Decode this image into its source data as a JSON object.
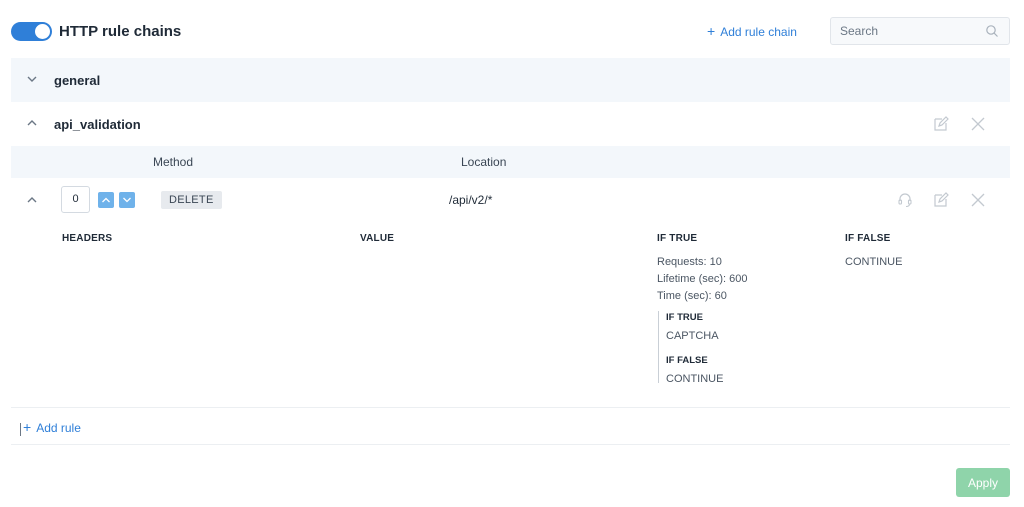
{
  "header": {
    "toggle_on": true,
    "title": "HTTP rule chains",
    "add_chain_label": "Add rule chain",
    "search_placeholder": "Search"
  },
  "chains": [
    {
      "name": "general",
      "expanded": false
    },
    {
      "name": "api_validation",
      "expanded": true
    }
  ],
  "rules_table": {
    "columns": {
      "method": "Method",
      "location": "Location"
    },
    "rule": {
      "order": "0",
      "method": "DELETE",
      "location": "/api/v2/*"
    }
  },
  "conditions": {
    "headers_label": "HEADERS",
    "value_label": "VALUE",
    "if_true_label": "IF TRUE",
    "if_false_label": "IF FALSE",
    "if_true_lines": [
      "Requests: 10",
      "Lifetime (sec): 600",
      "Time (sec): 60"
    ],
    "nested": {
      "if_true_label": "IF TRUE",
      "if_true_value": "CAPTCHA",
      "if_false_label": "IF FALSE",
      "if_false_value": "CONTINUE"
    },
    "if_false_value": "CONTINUE"
  },
  "footer": {
    "add_rule_label": "Add rule",
    "apply_label": "Apply"
  },
  "colors": {
    "accent": "#2f7fd8",
    "apply_disabled": "#8fd4aa",
    "row_highlight": "#f3f7fb"
  }
}
